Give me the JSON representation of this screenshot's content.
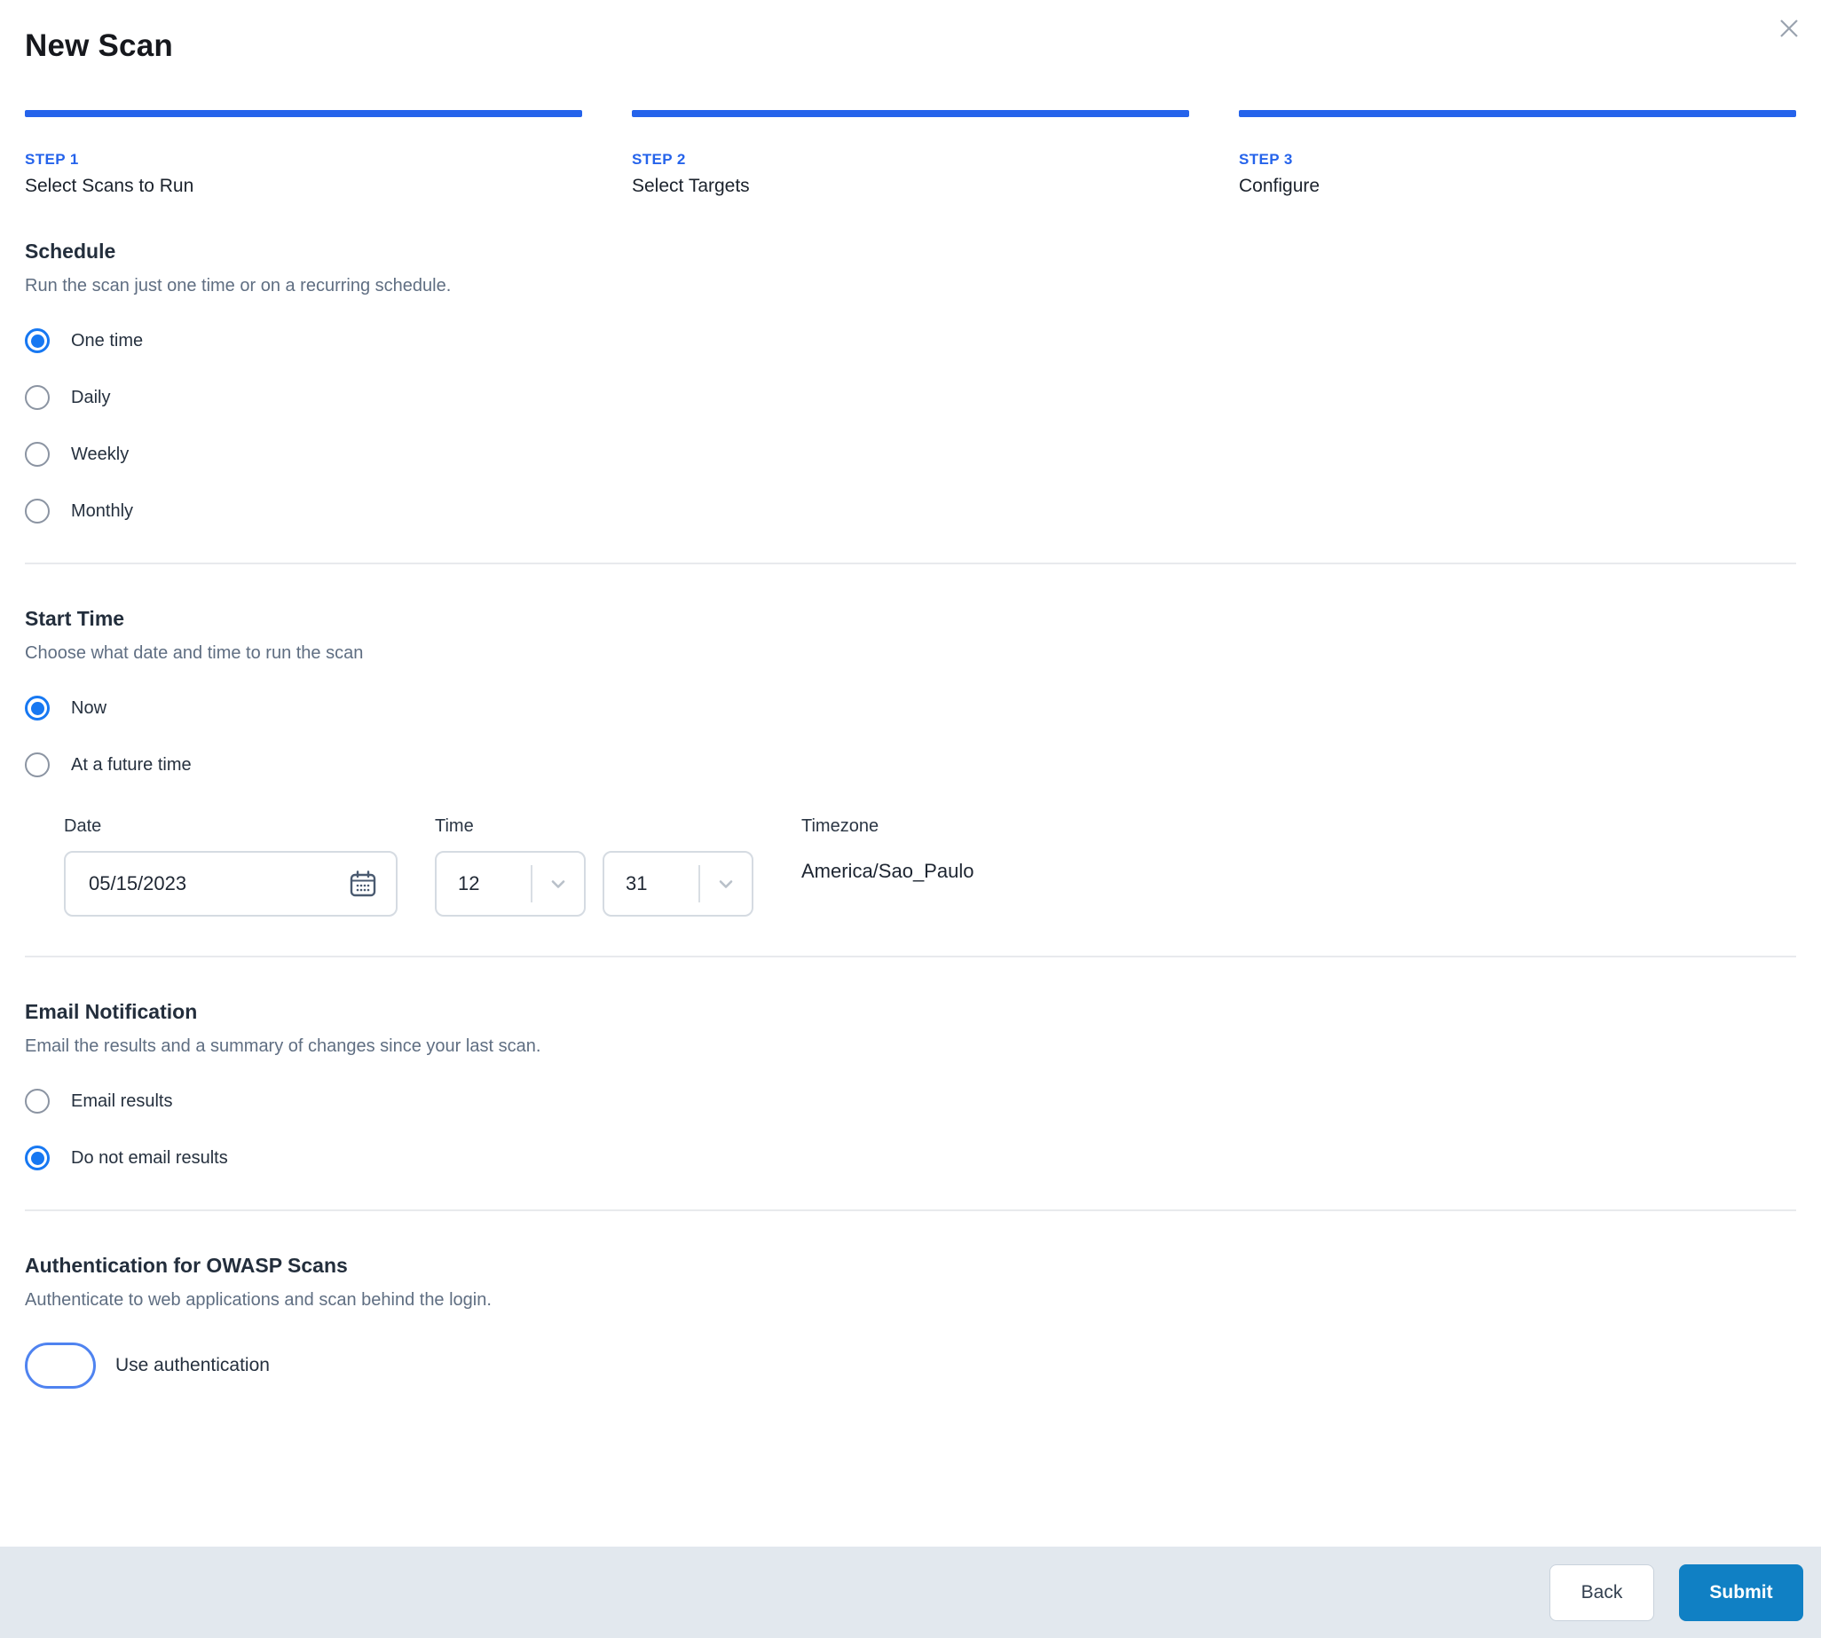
{
  "dialog": {
    "title": "New Scan"
  },
  "steps": [
    {
      "step_label": "STEP 1",
      "title": "Select Scans to Run"
    },
    {
      "step_label": "STEP 2",
      "title": "Select Targets"
    },
    {
      "step_label": "STEP 3",
      "title": "Configure"
    }
  ],
  "schedule": {
    "heading": "Schedule",
    "description": "Run the scan just one time or on a recurring schedule.",
    "options": [
      {
        "label": "One time",
        "selected": true
      },
      {
        "label": "Daily",
        "selected": false
      },
      {
        "label": "Weekly",
        "selected": false
      },
      {
        "label": "Monthly",
        "selected": false
      }
    ]
  },
  "start_time": {
    "heading": "Start Time",
    "description": "Choose what date and time to run the scan",
    "options": [
      {
        "label": "Now",
        "selected": true
      },
      {
        "label": "At a future time",
        "selected": false
      }
    ],
    "date": {
      "label": "Date",
      "value": "05/15/2023"
    },
    "time": {
      "label": "Time",
      "hour": "12",
      "minute": "31"
    },
    "timezone": {
      "label": "Timezone",
      "value": "America/Sao_Paulo"
    }
  },
  "email_notification": {
    "heading": "Email Notification",
    "description": "Email the results and a summary of changes since your last scan.",
    "options": [
      {
        "label": "Email results",
        "selected": false
      },
      {
        "label": "Do not email results",
        "selected": true
      }
    ]
  },
  "authentication": {
    "heading": "Authentication for OWASP Scans",
    "description": "Authenticate to web applications and scan behind the login.",
    "toggle_label": "Use authentication",
    "toggle_on": true
  },
  "footer": {
    "back_label": "Back",
    "submit_label": "Submit"
  },
  "colors": {
    "accent_blue": "#2563eb",
    "radio_blue": "#1778f2",
    "toggle_blue": "#2e6ce9",
    "submit_blue": "#1080c4",
    "footer_bg": "#e2e8ee",
    "divider": "#e8eaed",
    "close_icon_gray": "#9aa3af"
  }
}
